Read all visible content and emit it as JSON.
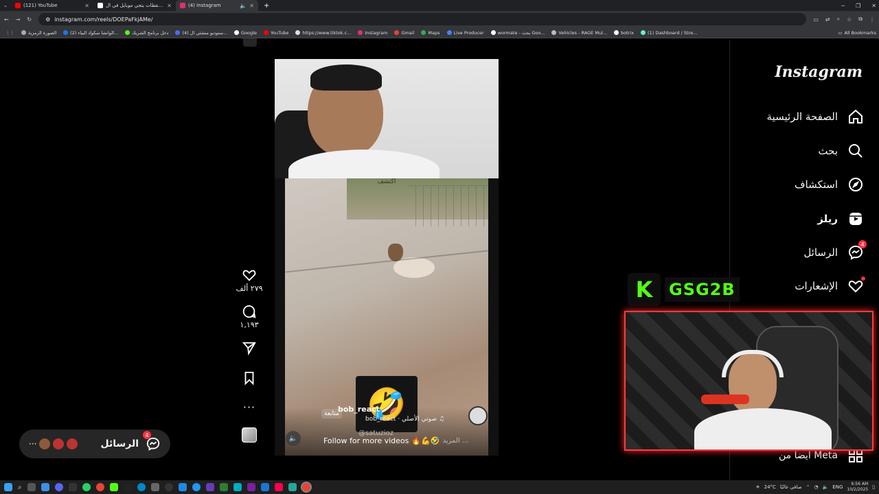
{
  "browser": {
    "tabs": [
      {
        "title": "(121) YouTube",
        "color": "#ff0000",
        "active": false
      },
      {
        "title": "أفضل لقطات يتجي موبايل في ال...",
        "color": "#ffffff",
        "active": false
      },
      {
        "title": "(4) Instagram",
        "color": "#e1306c",
        "active": true
      }
    ],
    "new_tab": "+",
    "url": "instagram.com/reels/DOEPaFkjAMe/",
    "bookmarks": [
      "الصورة الرمزية",
      "(2) الوانشا سكواد البياء...",
      "دخل برنامج الشريك",
      "(4) ستوديو منشئي ال...",
      "Google",
      "YouTube",
      "https://www.tiktok.c...",
      "Instagram",
      "Gmail",
      "Maps",
      "Live Producer",
      "wormate - بحث Goo...",
      "Vehicles - RAGE Mul...",
      "botrix",
      "(1) Dashboard / Stre..."
    ],
    "all_bookmarks": "All Bookmarks"
  },
  "sidebar": {
    "logo": "Instagram",
    "items": [
      {
        "label": "الصفحة الرئيسية",
        "icon": "home-icon"
      },
      {
        "label": "بحث",
        "icon": "search-icon"
      },
      {
        "label": "استكشاف",
        "icon": "compass-icon"
      },
      {
        "label": "ريلز",
        "icon": "reels-icon"
      },
      {
        "label": "الرسائل",
        "icon": "messenger-icon",
        "badge": "4"
      },
      {
        "label": "الإشعارات",
        "icon": "heart-icon"
      }
    ],
    "more": "ايضا من Meta"
  },
  "reel": {
    "username": "bob_react",
    "follow": "متابعة",
    "audio": "bob_react · صوتي الأصلي",
    "caption": "Follow for more videos",
    "more": "المزيد ...",
    "handle": "@satuzioz",
    "overlay_text": "اكتشف"
  },
  "actions": {
    "likes": "٢٧٩ ألف",
    "comments": "١,١٩٣"
  },
  "messages_bar": {
    "label": "الرسائل",
    "badge": "4"
  },
  "stream": {
    "kick_letter": "K",
    "name": "GSG2B"
  },
  "taskbar": {
    "weather": "24°C",
    "weather_text": "صافي غالبًا",
    "lang": "ENG",
    "time": "6:56 AM",
    "date": "10/2/2025"
  }
}
